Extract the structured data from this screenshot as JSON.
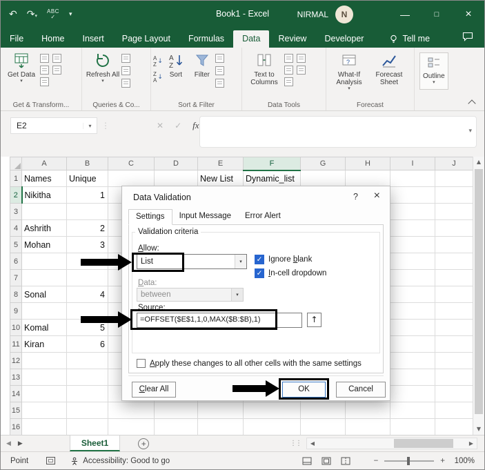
{
  "colors": {
    "excel_green": "#185C37",
    "accent_green": "#217346",
    "checkbox_blue": "#2765CF",
    "annotation_black": "#000000"
  },
  "title_bar": {
    "title": "Book1 - Excel",
    "user_name": "NIRMAL",
    "avatar_initial": "N"
  },
  "ribbon_tabs": {
    "items": [
      "File",
      "Home",
      "Insert",
      "Page Layout",
      "Formulas",
      "Data",
      "Review",
      "Developer"
    ],
    "active": "Data",
    "tell_me": "Tell me"
  },
  "ribbon": {
    "groups": [
      {
        "label": "Get & Transform...",
        "buttons": [
          "Get Data"
        ]
      },
      {
        "label": "Queries & Co...",
        "buttons": [
          "Refresh All"
        ]
      },
      {
        "label": "Sort & Filter",
        "buttons": [
          "Sort",
          "Filter"
        ]
      },
      {
        "label": "Data Tools",
        "buttons": [
          "Text to Columns"
        ]
      },
      {
        "label": "Forecast",
        "buttons": [
          "What-If Analysis",
          "Forecast Sheet"
        ]
      },
      {
        "label": "",
        "buttons": [
          "Outline"
        ]
      }
    ]
  },
  "formula_bar": {
    "name_box": "E2",
    "fx_label": "fx",
    "formula_value": ""
  },
  "grid": {
    "columns": [
      "A",
      "B",
      "C",
      "D",
      "E",
      "F",
      "G",
      "H",
      "I",
      "J"
    ],
    "rows": [
      "1",
      "2",
      "3",
      "4",
      "5",
      "6",
      "7",
      "8",
      "9",
      "10",
      "11",
      "12",
      "13",
      "14",
      "15",
      "16"
    ],
    "selected_column": "F",
    "selected_row": "2",
    "underlined_cells": [
      "E1",
      "F1"
    ],
    "cells": {
      "A1": "Names",
      "B1": "Unique",
      "E1": "New List",
      "F1": "Dynamic_list",
      "A2": "Nikitha",
      "B2": "1",
      "A4": "Ashrith",
      "B4": "2",
      "A5": "Mohan",
      "B5": "3",
      "A8": "Sonal",
      "B8": "4",
      "A10": "Komal",
      "B10": "5",
      "A11": "Kiran",
      "B11": "6"
    }
  },
  "dialog": {
    "title": "Data Validation",
    "tabs": [
      "Settings",
      "Input Message",
      "Error Alert"
    ],
    "active_tab": "Settings",
    "criteria_label": "Validation criteria",
    "allow_label": "Allow:",
    "allow_value": "List",
    "ignore_blank_label": "Ignore blank",
    "in_cell_dropdown_label": "In-cell dropdown",
    "data_label": "Data:",
    "data_value": "between",
    "source_label": "Source:",
    "source_value": "=OFFSET($E$1,1,0,MAX($B:$B),1)",
    "apply_label": "Apply these changes to all other cells with the same settings",
    "clear_all_label": "Clear All",
    "ok_label": "OK",
    "cancel_label": "Cancel"
  },
  "sheet_bar": {
    "active_sheet": "Sheet1"
  },
  "status_bar": {
    "mode": "Point",
    "accessibility": "Accessibility: Good to go",
    "zoom_level": "100%"
  }
}
